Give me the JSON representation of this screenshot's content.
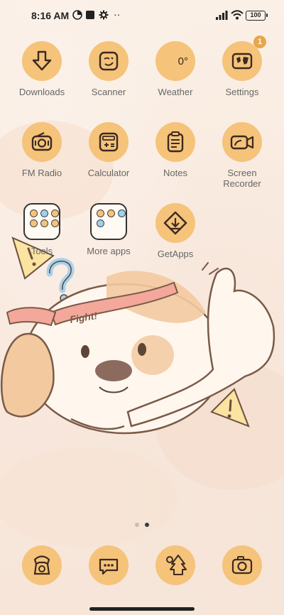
{
  "status_bar": {
    "time": "8:16 AM",
    "battery": "100"
  },
  "apps": [
    {
      "label": "Downloads",
      "icon": "download-icon"
    },
    {
      "label": "Scanner",
      "icon": "scanner-icon"
    },
    {
      "label": "Weather",
      "icon": "weather-icon",
      "value": "0°"
    },
    {
      "label": "Settings",
      "icon": "settings-icon",
      "badge": "1"
    },
    {
      "label": "FM Radio",
      "icon": "radio-icon"
    },
    {
      "label": "Calculator",
      "icon": "calculator-icon"
    },
    {
      "label": "Notes",
      "icon": "notes-icon"
    },
    {
      "label": "Screen\nRecorder",
      "icon": "screen-recorder-icon"
    },
    {
      "label": "Tools",
      "icon": "folder-icon"
    },
    {
      "label": "More apps",
      "icon": "folder-icon"
    },
    {
      "label": "GetApps",
      "icon": "getapps-icon"
    }
  ],
  "wallpaper": {
    "text": "Fight!"
  },
  "page_indicator": {
    "current_page": 2,
    "total_pages": 2
  },
  "dock": [
    {
      "icon": "phone-icon"
    },
    {
      "icon": "messages-icon"
    },
    {
      "icon": "gallery-icon"
    },
    {
      "icon": "camera-icon"
    }
  ],
  "colors": {
    "icon_bg": "#f5c37a",
    "icon_stroke": "#3b2a20",
    "label": "#666666"
  }
}
